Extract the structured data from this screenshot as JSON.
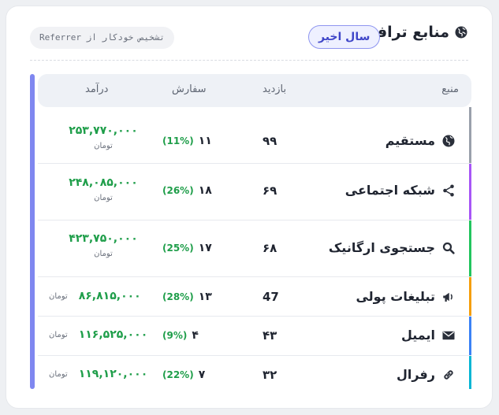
{
  "header": {
    "title": "منابع ترافیک",
    "period_label": "سال اخیر",
    "auto_badge": "تشخیص خودکار از Referrer"
  },
  "table": {
    "columns": {
      "source": "منبع",
      "visits": "بازدید",
      "orders": "سفارش",
      "revenue": "درآمد"
    },
    "rows": [
      {
        "source": "مستقیم",
        "icon": "globe-icon",
        "color": "#9aa0ab",
        "visits": "۹۹",
        "orders": "۱۱",
        "pct": "(11%)",
        "revenue": "۲۵۳,۷۷۰,۰۰۰",
        "currency": "تومان"
      },
      {
        "source": "شبکه اجتماعی",
        "icon": "share-icon",
        "color": "#a855f7",
        "visits": "۶۹",
        "orders": "۱۸",
        "pct": "(26%)",
        "revenue": "۲۴۸,۰۸۵,۰۰۰",
        "currency": "تومان"
      },
      {
        "source": "جستجوی ارگانیک",
        "icon": "search-icon",
        "color": "#22c55e",
        "visits": "۶۸",
        "orders": "۱۷",
        "pct": "(25%)",
        "revenue": "۴۲۳,۷۵۰,۰۰۰",
        "currency": "تومان"
      },
      {
        "source": "تبلیغات پولی",
        "icon": "megaphone-icon",
        "color": "#f59e0b",
        "visits": "47",
        "orders": "۱۳",
        "pct": "(28%)",
        "revenue": "۸۶,۸۱۵,۰۰۰",
        "currency": "تومان"
      },
      {
        "source": "ایمیل",
        "icon": "mail-icon",
        "color": "#3b82f6",
        "visits": "۴۳",
        "orders": "۴",
        "pct": "(9%)",
        "revenue": "۱۱۶,۵۲۵,۰۰۰",
        "currency": "تومان"
      },
      {
        "source": "رفرال",
        "icon": "link-icon",
        "color": "#06b6d4",
        "visits": "۳۲",
        "orders": "۷",
        "pct": "(22%)",
        "revenue": "۱۱۹,۱۲۰,۰۰۰",
        "currency": "تومان"
      }
    ]
  }
}
